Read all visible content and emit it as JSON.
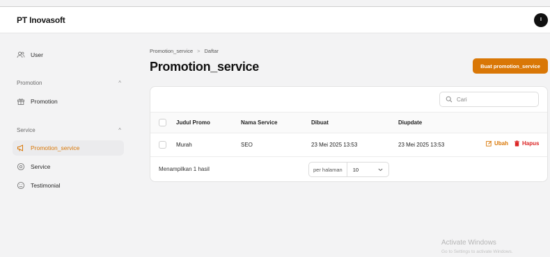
{
  "app": {
    "title": "PT Inovasoft",
    "avatar_initial": "I"
  },
  "sidebar": {
    "user_label": "User",
    "groups": [
      {
        "label": "Promotion",
        "items": [
          {
            "label": "Promotion",
            "icon": "gift-icon"
          }
        ]
      },
      {
        "label": "Service",
        "items": [
          {
            "label": "Promotion_service",
            "icon": "megaphone-icon",
            "active": true
          },
          {
            "label": "Service",
            "icon": "settings-icon"
          },
          {
            "label": "Testimonial",
            "icon": "smile-icon"
          }
        ]
      }
    ]
  },
  "breadcrumb": {
    "first": "Promotion_service",
    "sep": ">",
    "second": "Daftar"
  },
  "page": {
    "title": "Promotion_service",
    "create_button": "Buat promotion_service"
  },
  "search": {
    "placeholder": "Cari"
  },
  "table": {
    "headers": [
      "Judul Promo",
      "Nama Service",
      "Dibuat",
      "Diupdate"
    ],
    "rows": [
      {
        "judul": "Murah",
        "service": "SEO",
        "dibuat": "23 Mei 2025 13:53",
        "diupdate": "23 Mei 2025 13:53",
        "edit_label": "Ubah",
        "delete_label": "Hapus"
      }
    ]
  },
  "pagination": {
    "summary": "Menampilkan 1 hasil",
    "per_page_label": "per halaman",
    "per_page_value": "10"
  },
  "watermark": {
    "title": "Activate Windows",
    "subtitle": "Go to Settings to activate Windows."
  },
  "colors": {
    "accent": "#d97706",
    "danger": "#dc2626"
  }
}
